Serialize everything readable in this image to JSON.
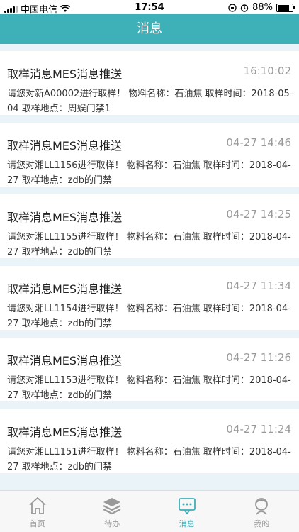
{
  "status_bar": {
    "carrier": "中国电信",
    "time": "17:54",
    "battery": "88%",
    "battery_level": 0.88
  },
  "header": {
    "title": "消息"
  },
  "messages": [
    {
      "title": "取样消息MES消息推送",
      "time": "16:10:02",
      "body": "请您对新A00002进行取样！ 物料名称：石油焦 取样时间：2018-05-04 取样地点：周娱门禁1"
    },
    {
      "title": "取样消息MES消息推送",
      "time": "04-27 14:46",
      "body": "请您对湘LL1156进行取样！ 物料名称：石油焦 取样时间：2018-04-27 取样地点：zdb的门禁"
    },
    {
      "title": "取样消息MES消息推送",
      "time": "04-27 14:25",
      "body": "请您对湘LL1155进行取样！ 物料名称：石油焦 取样时间：2018-04-27 取样地点：zdb的门禁"
    },
    {
      "title": "取样消息MES消息推送",
      "time": "04-27 11:34",
      "body": "请您对湘LL1154进行取样！ 物料名称：石油焦 取样时间：2018-04-27 取样地点：zdb的门禁"
    },
    {
      "title": "取样消息MES消息推送",
      "time": "04-27 11:26",
      "body": "请您对湘LL1153进行取样！ 物料名称：石油焦 取样时间：2018-04-27 取样地点：zdb的门禁"
    },
    {
      "title": "取样消息MES消息推送",
      "time": "04-27 11:24",
      "body": "请您对湘LL1151进行取样！ 物料名称：石油焦 取样时间：2018-04-27 取样地点：zdb的门禁"
    }
  ],
  "tabbar": {
    "active_color": "#3eb0b8",
    "inactive_color": "#999999",
    "items": [
      {
        "label": "首页",
        "icon": "home-icon"
      },
      {
        "label": "待办",
        "icon": "layers-icon"
      },
      {
        "label": "消息",
        "icon": "chat-icon"
      },
      {
        "label": "我的",
        "icon": "user-icon"
      }
    ]
  }
}
